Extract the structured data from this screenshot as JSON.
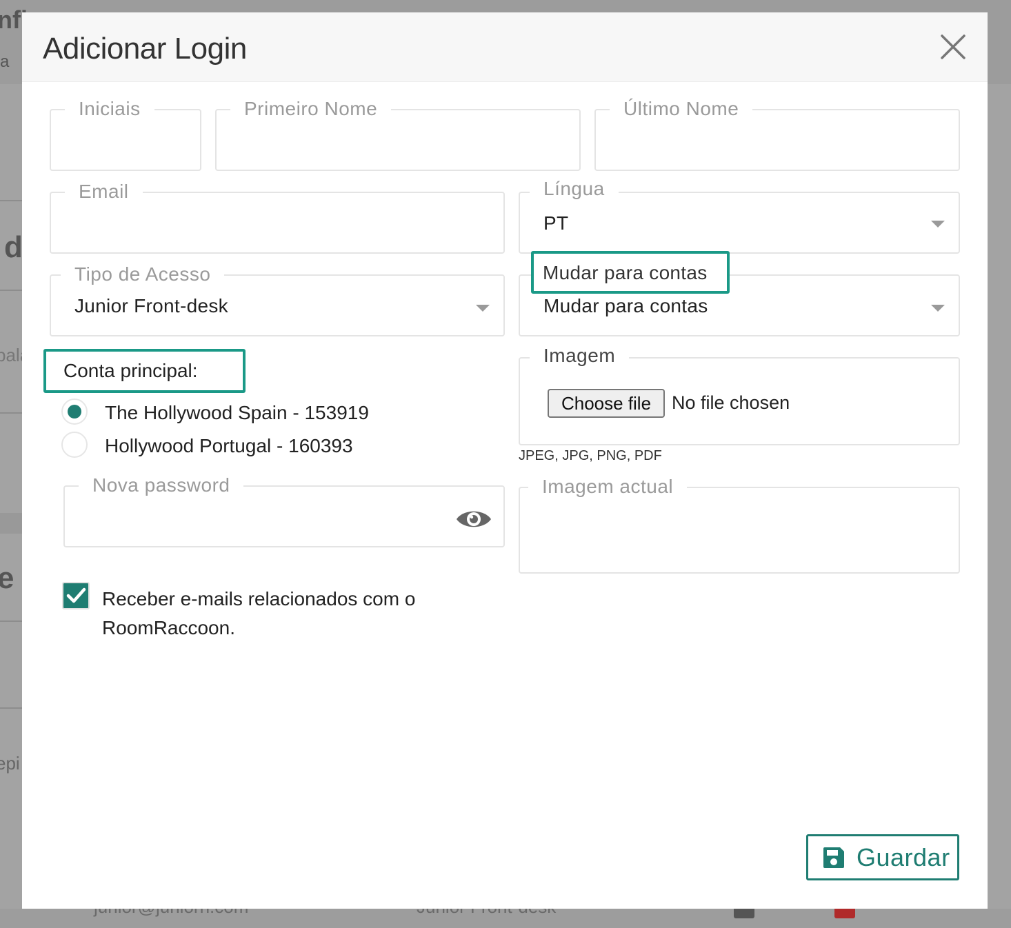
{
  "modal": {
    "title": "Adicionar Login",
    "close_icon": "close-icon"
  },
  "fields": {
    "initials": {
      "label": "Iniciais",
      "value": ""
    },
    "first_name": {
      "label": "Primeiro Nome",
      "value": ""
    },
    "last_name": {
      "label": "Último Nome",
      "value": ""
    },
    "email": {
      "label": "Email",
      "value": ""
    },
    "language": {
      "label": "Língua",
      "value": "PT"
    },
    "access_type": {
      "label": "Tipo de Acesso",
      "value": "Junior Front-desk"
    },
    "switch_accounts": {
      "label": "Mudar para contas",
      "value": "Mudar para contas"
    },
    "main_account": {
      "label": "Conta principal:",
      "options": [
        {
          "label": "The Hollywood Spain - 153919",
          "checked": true
        },
        {
          "label": "Hollywood Portugal - 160393",
          "checked": false
        }
      ]
    },
    "image": {
      "label": "Imagem",
      "button": "Choose file",
      "status": "No file chosen",
      "hint": "JPEG, JPG, PNG, PDF"
    },
    "new_password": {
      "label": "Nova password",
      "value": "",
      "icon": "eye-icon"
    },
    "current_image": {
      "label": "Imagem actual"
    },
    "receive_emails": {
      "label": "Receber e-mails relacionados com o RoomRaccoon.",
      "checked": true
    }
  },
  "actions": {
    "save": "Guardar",
    "save_icon": "floppy-disk-icon"
  },
  "colors": {
    "accent": "#1f7d72",
    "highlight": "#1a9987"
  },
  "background": {
    "fragments": [
      "nfi",
      "a",
      "d",
      "pala",
      "e",
      "epi"
    ],
    "bottom_text": [
      "junior@juniorn.com",
      "Junior Front-desk"
    ]
  }
}
